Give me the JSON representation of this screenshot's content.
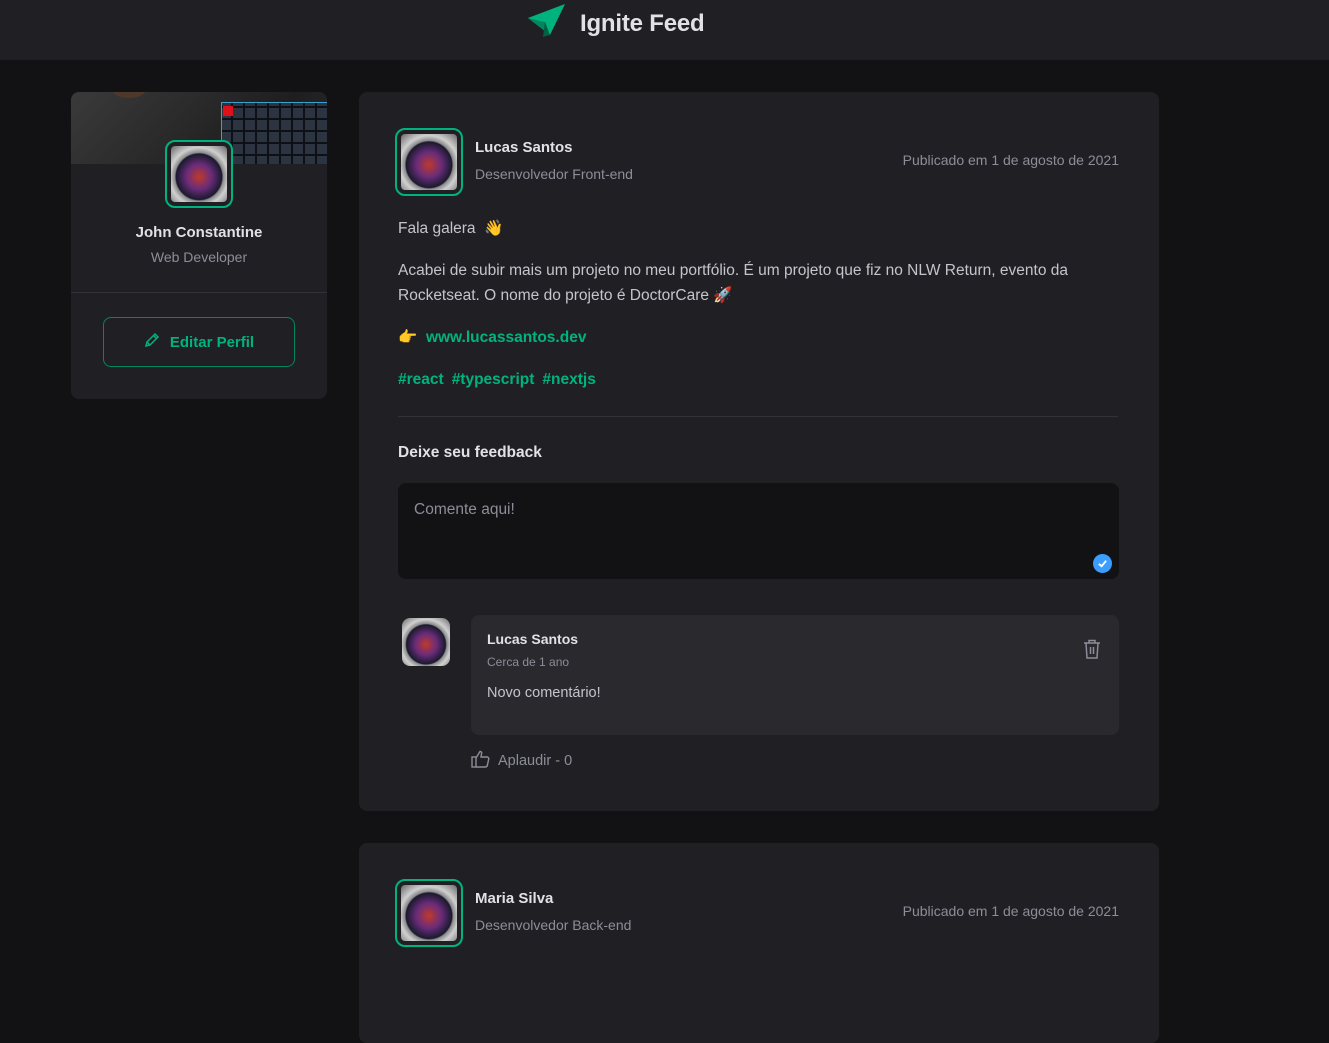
{
  "app": {
    "title": "Ignite Feed"
  },
  "profile": {
    "name": "John Constantine",
    "role": "Web Developer",
    "edit_label": "Editar Perfil"
  },
  "posts": [
    {
      "author": {
        "name": "Lucas Santos",
        "role": "Desenvolvedor Front-end"
      },
      "published": "Publicado em 1 de agosto de 2021",
      "greeting": "Fala galera",
      "greeting_emoji": "👋",
      "body": "Acabei de subir mais um projeto no meu portfólio. É um projeto que fiz no NLW Return, evento da Rocketseat. O nome do projeto é DoctorCare",
      "body_emoji": "🚀",
      "link_emoji": "👉",
      "link": "www.lucassantos.dev",
      "tags": [
        "#react",
        "#typescript",
        "#nextjs"
      ],
      "feedback_title": "Deixe seu feedback",
      "comment_placeholder": "Comente aqui!",
      "comments": [
        {
          "author": "Lucas Santos",
          "time": "Cerca de 1 ano",
          "text": "Novo comentário!",
          "applaud_label": "Aplaudir - 0"
        }
      ]
    },
    {
      "author": {
        "name": "Maria Silva",
        "role": "Desenvolvedor Back-end"
      },
      "published": "Publicado em 1 de agosto de 2021"
    }
  ],
  "colors": {
    "background": "#121214",
    "surface": "#202024",
    "accent": "#00b37e",
    "text": "#c4c4cc",
    "muted": "#8d8d99"
  },
  "icons": {
    "logo": "paper-plane-logo-icon",
    "edit": "pencil-icon",
    "check": "check-icon",
    "trash": "trash-icon",
    "applaud": "thumbs-up-icon"
  }
}
